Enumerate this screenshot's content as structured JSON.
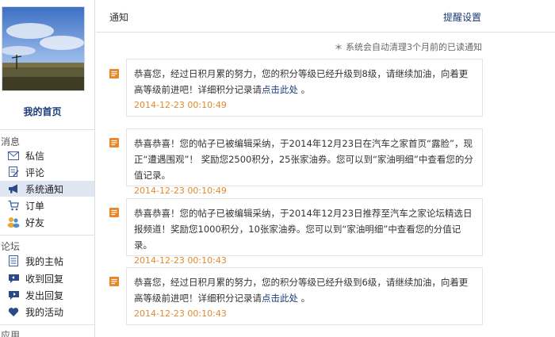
{
  "sidebar": {
    "home_label": "我的首页",
    "section_messages": "消息",
    "messages_items": [
      {
        "label": "私信",
        "icon": "envelope-icon"
      },
      {
        "label": "评论",
        "icon": "comment-edit-icon"
      },
      {
        "label": "系统通知",
        "icon": "megaphone-icon",
        "active": true
      },
      {
        "label": "订单",
        "icon": "cart-icon"
      },
      {
        "label": "好友",
        "icon": "friends-icon"
      }
    ],
    "section_forum": "论坛",
    "forum_items": [
      {
        "label": "我的主帖",
        "icon": "document-icon"
      },
      {
        "label": "收到回复",
        "icon": "reply-in-icon"
      },
      {
        "label": "发出回复",
        "icon": "reply-out-icon"
      },
      {
        "label": "我的活动",
        "icon": "heart-icon"
      }
    ],
    "section_apps": "应用"
  },
  "header": {
    "title": "通知",
    "reminder_settings": "提醒设置"
  },
  "auto_clean_note": "＊ 系统会自动清理3个月前的已读通知",
  "notices": [
    {
      "text": "恭喜您，经过日积月累的努力，您的积分等级已经升级到8级，请继续加油，向着更高等级前进吧！详细积分记录请",
      "link": "点击此处",
      "suffix": " 。",
      "time": "2014-12-23 00:10:49"
    },
    {
      "text": "恭喜恭喜！您的帖子已被编辑采纳，于2014年12月23日在汽车之家首页“露脸”，现正“遭遇围观”！ 奖励您2500积分，25张家油券。您可以到“家油明细”中查看您的分值记录。",
      "link": "",
      "suffix": "",
      "time": "2014-12-23 00:10:49"
    },
    {
      "text": "恭喜恭喜！您的帖子已被编辑采纳，于2014年12月23日推荐至汽车之家论坛精选日报频道！奖励您1000积分，10张家油券。您可以到“家油明细”中查看您的分值记录。",
      "link": "",
      "suffix": "",
      "time": "2014-12-23 00:10:43"
    },
    {
      "text": "恭喜您，经过日积月累的努力，您的积分等级已经升级到6级，请继续加油，向着更高等级前进吧！详细积分记录请",
      "link": "点击此处",
      "suffix": " 。",
      "time": "2014-12-23 00:10:43"
    }
  ],
  "colors": {
    "link": "#1a3b78",
    "timestamp": "#e08a2e",
    "active_nav": "#dfe6f2",
    "notice_icon": "#e8862a"
  }
}
